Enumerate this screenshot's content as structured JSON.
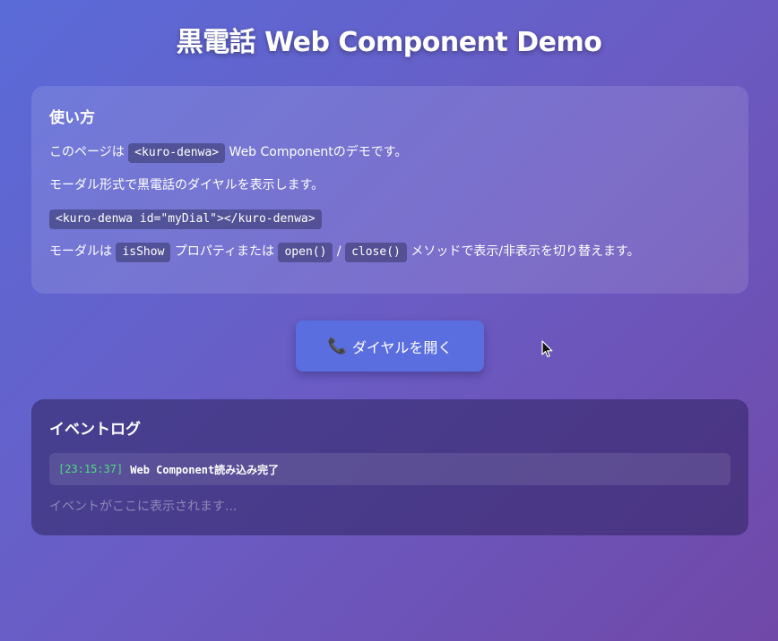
{
  "page": {
    "title": "黒電話 Web Component Demo"
  },
  "usage": {
    "heading": "使い方",
    "line1": {
      "before": "このページは ",
      "code": "<kuro-denwa>",
      "after": " Web Componentのデモです。"
    },
    "line2": "モーダル形式で黒電話のダイヤルを表示します。",
    "line3_code": "<kuro-denwa id=\"myDial\"></kuro-denwa>",
    "line4": {
      "before": "モーダルは ",
      "code1": "isShow",
      "middle": " プロパティまたは ",
      "code2": "open()",
      "sep": " / ",
      "code3": "close()",
      "after": " メソッドで表示/非表示を切り替えます。"
    }
  },
  "open_button": {
    "icon": "phone-icon",
    "label": "ダイヤルを開く"
  },
  "event_log": {
    "heading": "イベントログ",
    "entries": [
      {
        "time": "[23:15:37]",
        "message": "Web Component読み込み完了"
      }
    ],
    "placeholder": "イベントがここに表示されます..."
  },
  "colors": {
    "accent": "#5b6ee0",
    "log_time": "#4ade80"
  }
}
